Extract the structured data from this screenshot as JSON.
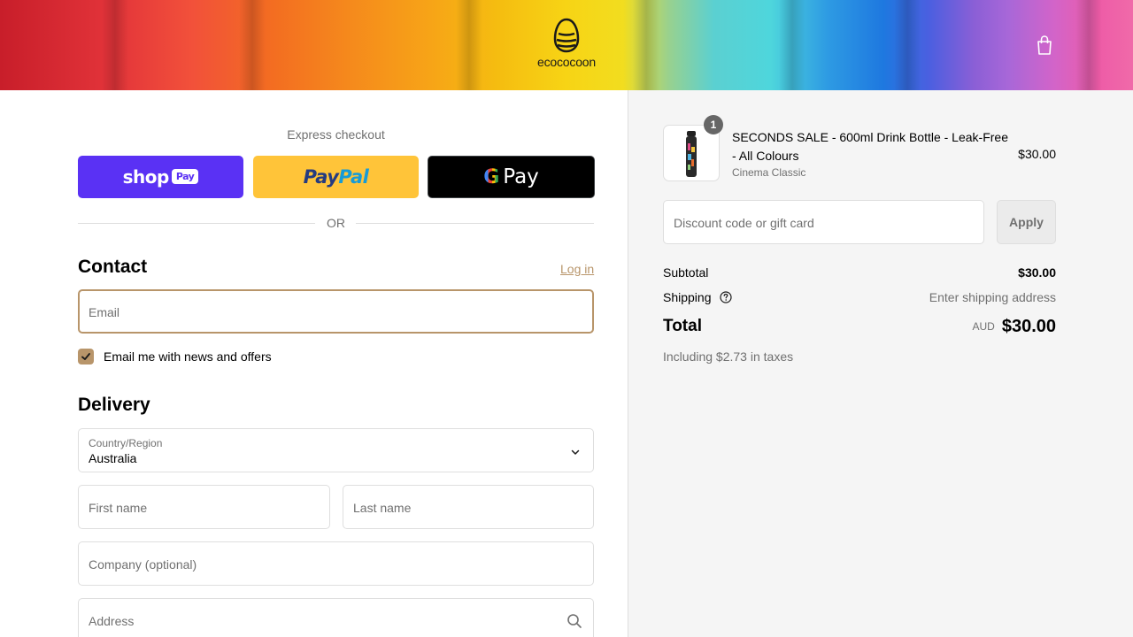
{
  "header": {
    "brand": "ecococoon",
    "cart_icon": "shopping-bag-icon"
  },
  "express_checkout": {
    "title": "Express checkout",
    "shop_pay": {
      "shop": "shop",
      "pay": "Pay",
      "color": "#5a31f4"
    },
    "paypal": {
      "pay": "Pay",
      "pal": "Pal",
      "color": "#ffc439"
    },
    "google_pay": {
      "g": "G",
      "pay": "Pay",
      "color": "#000000"
    },
    "divider_text": "OR"
  },
  "contact": {
    "title": "Contact",
    "login_link": "Log in",
    "email_placeholder": "Email",
    "newsletter_label": "Email me with news and offers",
    "newsletter_checked": true
  },
  "delivery": {
    "title": "Delivery",
    "country_label": "Country/Region",
    "country_value": "Australia",
    "first_name_placeholder": "First name",
    "last_name_placeholder": "Last name",
    "company_placeholder": "Company (optional)",
    "address_placeholder": "Address"
  },
  "order_summary": {
    "item": {
      "quantity": "1",
      "name": "SECONDS SALE - 600ml Drink Bottle - Leak-Free - All Colours",
      "variant": "Cinema Classic",
      "price": "$30.00"
    },
    "discount_placeholder": "Discount code or gift card",
    "apply_label": "Apply",
    "subtotal_label": "Subtotal",
    "subtotal_value": "$30.00",
    "shipping_label": "Shipping",
    "shipping_value": "Enter shipping address",
    "total_label": "Total",
    "total_currency": "AUD",
    "total_value": "$30.00",
    "tax_note": "Including $2.73 in taxes"
  },
  "colors": {
    "accent": "#b8956a",
    "summary_bg": "#f5f5f5",
    "muted_text": "#707070"
  }
}
